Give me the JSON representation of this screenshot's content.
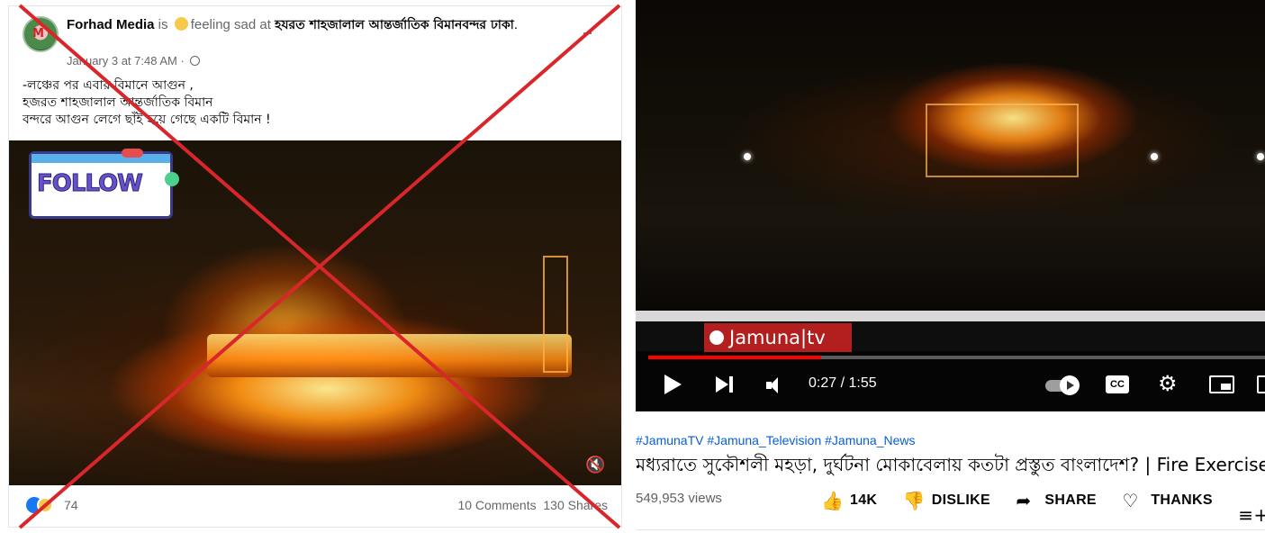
{
  "facebook_post": {
    "author": "Forhad Media",
    "feeling_prefix": " is ",
    "feeling": "feeling sad at ",
    "place": "হযরত শাহজালাল আন্তর্জাতিক বিমানবন্দর ঢাকা",
    "place_suffix": ".",
    "timestamp": "January 3 at 7:48 AM · ",
    "text_lines": [
      "-লঞ্চের পর এবার বিমানে  আগুন ,",
      "হজরত শাহজালাল আন্তর্জাতিক বিমান",
      "বন্দরে আগুন লেগে ছাঁই হয়ে গেছে একটি বিমান !"
    ],
    "overlay_sticker": "FOLLOW",
    "reactions_count": "74",
    "comments": "10 Comments",
    "shares": "130 Shares",
    "more_icon": "more-horizontal-icon",
    "privacy_icon": "globe-icon",
    "mute_icon": "volume-mute-icon"
  },
  "debunk_mark": {
    "color": "#d9262b",
    "shape": "x-cross"
  },
  "youtube": {
    "channel_watermark": "Jamuna|tv",
    "progress_fraction": 0.28,
    "time": "0:27 / 1:55",
    "tags": "#JamunaTV #Jamuna_Television #Jamuna_News",
    "title": "মধ্যরাতে সুকৌশলী মহড়া, দুর্ঘটনা মোকাবেলায় কতটা প্রস্তুত বাংলাদেশ? | Fire Exercise",
    "views": "549,953 views",
    "actions": {
      "like_count": "14K",
      "dislike": "DISLIKE",
      "share": "SHARE",
      "thanks": "THANKS"
    },
    "cc_label": "CC",
    "colors": {
      "progress": "#ff0000",
      "link": "#065fd4",
      "jamuna_red": "#b31e1e"
    }
  }
}
